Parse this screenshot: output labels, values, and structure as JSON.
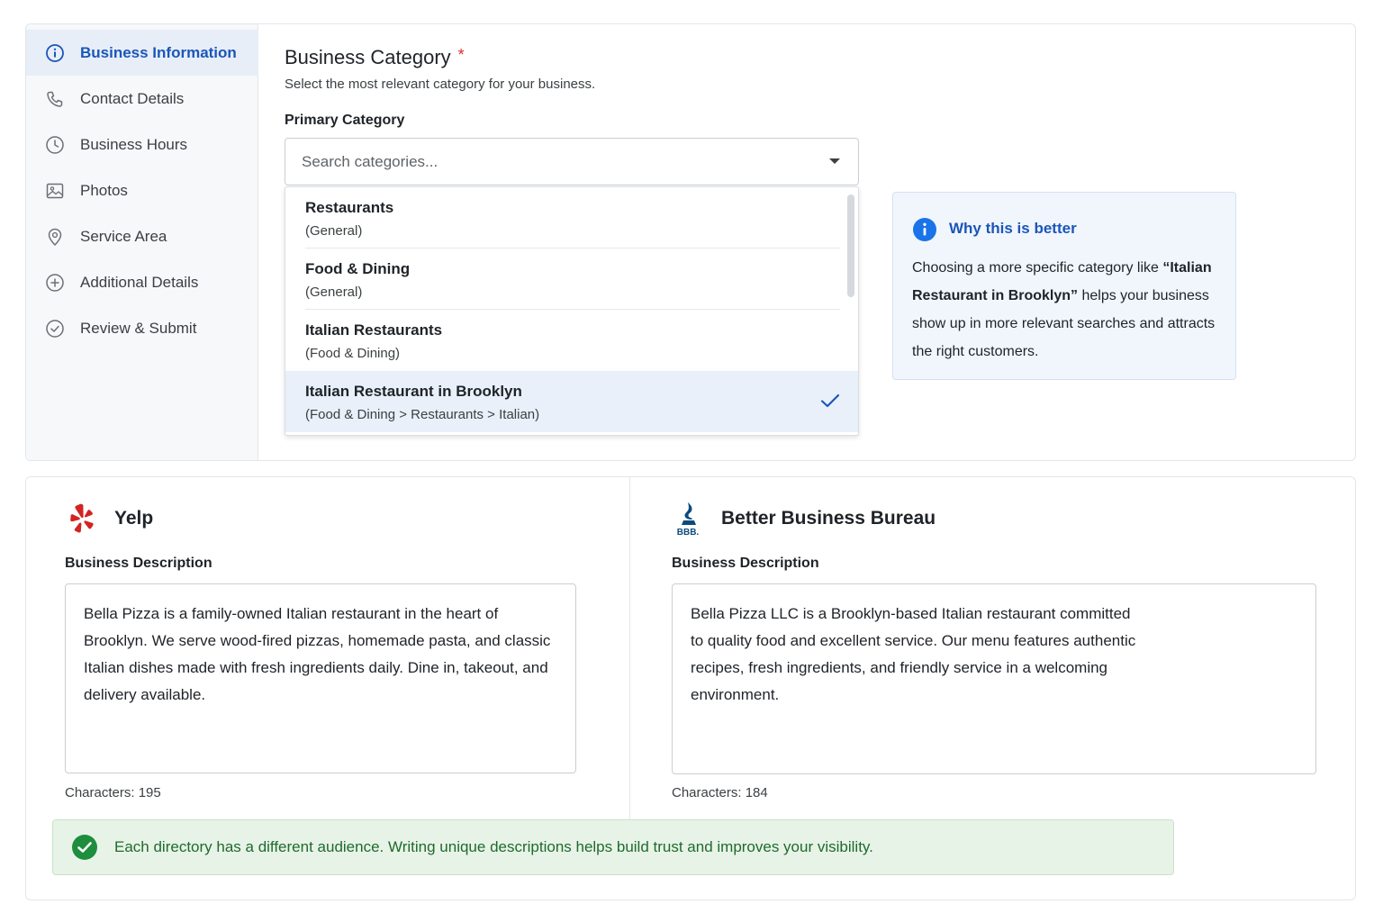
{
  "sidebar": {
    "items": [
      {
        "label": "Business Information",
        "icon": "info-icon",
        "active": true
      },
      {
        "label": "Contact Details",
        "icon": "phone-icon"
      },
      {
        "label": "Business Hours",
        "icon": "clock-icon"
      },
      {
        "label": "Photos",
        "icon": "image-icon"
      },
      {
        "label": "Service Area",
        "icon": "location-pin-icon"
      },
      {
        "label": "Additional Details",
        "icon": "plus-circle-icon"
      },
      {
        "label": "Review & Submit",
        "icon": "check-circle-icon"
      }
    ]
  },
  "category": {
    "title": "Business Category",
    "required_mark": "*",
    "subtitle": "Select the most relevant category for your business.",
    "field_label": "Primary Category",
    "search_placeholder": "Search categories...",
    "options": [
      {
        "name": "Restaurants",
        "path": "(General)"
      },
      {
        "name": "Food & Dining",
        "path": "(General)"
      },
      {
        "name": "Italian Restaurants",
        "path": "(Food & Dining)"
      },
      {
        "name": "Italian Restaurant in Brooklyn",
        "path": "(Food & Dining > Restaurants > Italian)",
        "selected": true
      }
    ]
  },
  "info_card": {
    "title": "Why this is better",
    "body_pre": "Choosing a more specific category like ",
    "body_bold": "“Italian Restaurant in Brooklyn”",
    "body_post": " helps your business show up in more relevant searches and attracts the right customers."
  },
  "directories": [
    {
      "name": "Yelp",
      "logo": "yelp-logo-icon",
      "desc_label": "Business Description",
      "description": "Bella Pizza is a family-owned Italian restaurant in the heart of Brooklyn. We serve wood-fired pizzas, homemade pasta, and classic Italian dishes made with fresh ingredients daily. Dine in, takeout, and delivery available.",
      "char_count": "Characters: 195"
    },
    {
      "name": "Better Business Bureau",
      "logo": "bbb-logo-icon",
      "logo_text": "BBB.",
      "desc_label": "Business Description",
      "description": "Bella Pizza LLC is a Brooklyn-based Italian restaurant committed to quality food and excellent service. Our menu features authentic recipes, fresh ingredients, and friendly service in a welcoming environment.",
      "char_count": "Characters: 184"
    }
  ],
  "success_message": "Each directory has a different audience.  Writing unique descriptions helps build trust and improves your visibility.",
  "colors": {
    "accent": "#1a56b8",
    "success": "#1e8e3e",
    "yelp_red": "#d32323",
    "bbb_blue": "#0b4a7d"
  }
}
